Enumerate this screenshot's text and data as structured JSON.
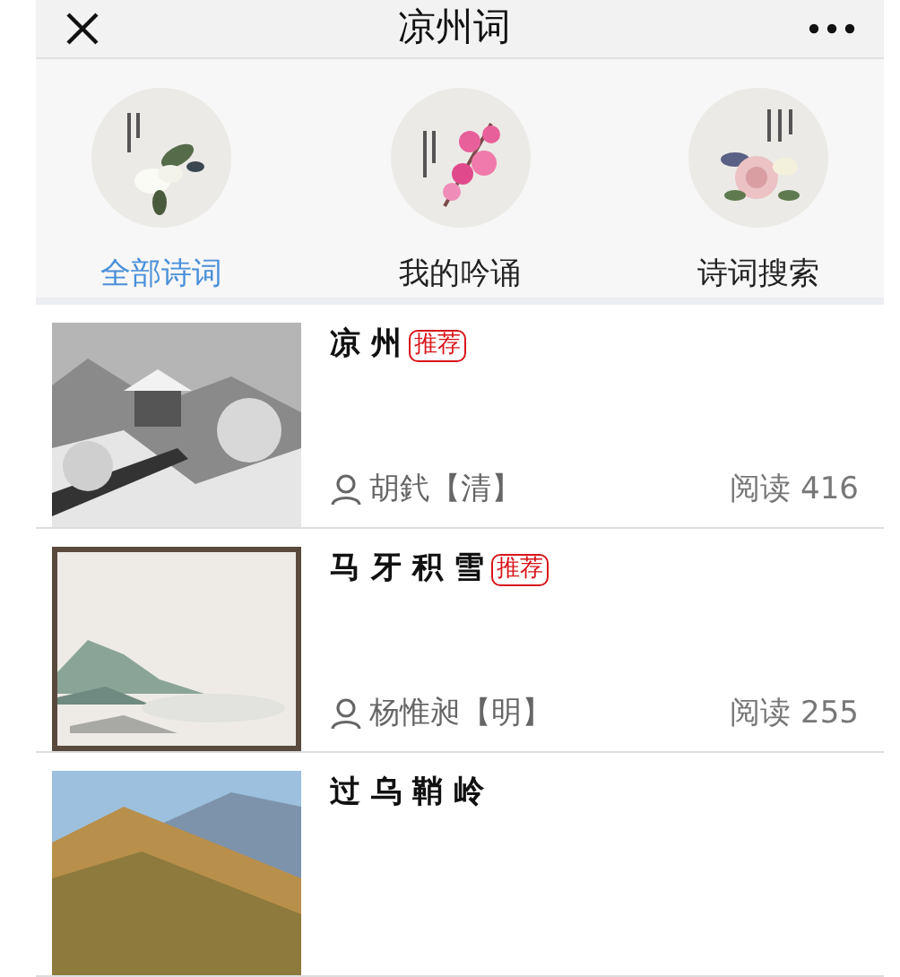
{
  "header": {
    "title": "凉州词"
  },
  "categories": [
    {
      "label": "全部诗词",
      "selected": true
    },
    {
      "label": "我的吟诵",
      "selected": false
    },
    {
      "label": "诗词搜索",
      "selected": false
    }
  ],
  "poems": [
    {
      "title": "凉 州",
      "badge": "推荐",
      "author": "胡釴【清】",
      "reads": "阅读 416"
    },
    {
      "title": "马 牙 积 雪",
      "badge": "推荐",
      "author": "杨惟昶【明】",
      "reads": "阅读 255"
    },
    {
      "title": "过 乌 鞘 岭"
    }
  ]
}
